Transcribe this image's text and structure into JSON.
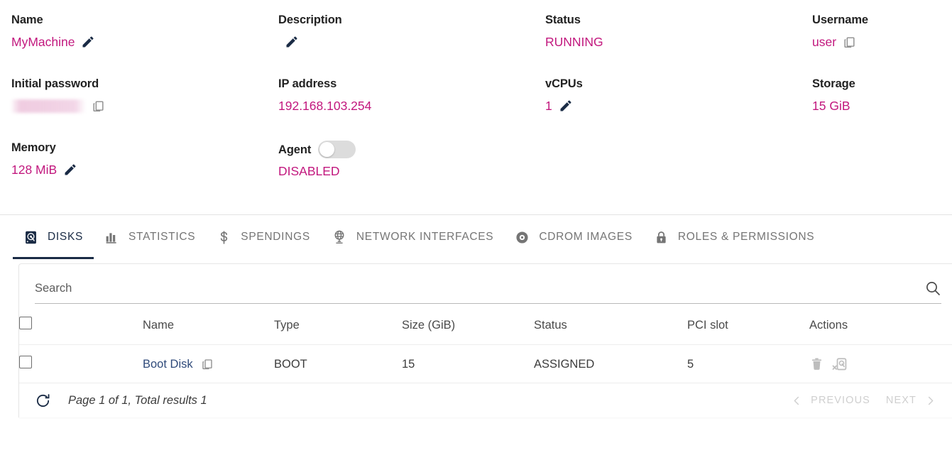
{
  "accent_color": "#c2187e",
  "navy_color": "#1a2b45",
  "link_color": "#2f4a7a",
  "summary": {
    "fields": [
      {
        "label": "Name",
        "value": "MyMachine",
        "icon": "pencil-icon"
      },
      {
        "label": "Description",
        "value": "",
        "icon": "pencil-icon"
      },
      {
        "label": "Status",
        "value": "RUNNING",
        "icon": ""
      },
      {
        "label": "Username",
        "value": "user",
        "icon": "copy-icon"
      },
      {
        "label": "Initial password",
        "value": "",
        "icon": "copy-icon"
      },
      {
        "label": "IP address",
        "value": "192.168.103.254",
        "icon": ""
      },
      {
        "label": "vCPUs",
        "value": "1",
        "icon": "pencil-icon"
      },
      {
        "label": "Storage",
        "value": "15 GiB",
        "icon": ""
      },
      {
        "label": "Memory",
        "value": "128 MiB",
        "icon": "pencil-icon"
      },
      {
        "label": "Agent",
        "value": "DISABLED",
        "icon": "toggle-switch",
        "toggle_state": "off"
      }
    ]
  },
  "tabs": [
    {
      "label": "DISKS",
      "icon": "harddisk-icon",
      "active": true
    },
    {
      "label": "STATISTICS",
      "icon": "barchart-icon",
      "active": false
    },
    {
      "label": "SPENDINGS",
      "icon": "dollar-icon",
      "active": false
    },
    {
      "label": "NETWORK INTERFACES",
      "icon": "globe-icon",
      "active": false
    },
    {
      "label": "CDROM IMAGES",
      "icon": "disc-icon",
      "active": false
    },
    {
      "label": "ROLES & PERMISSIONS",
      "icon": "lock-icon",
      "active": false
    }
  ],
  "search": {
    "placeholder": "Search",
    "value": "",
    "icon": "search-icon"
  },
  "table": {
    "columns": [
      "",
      "Name",
      "Type",
      "Size (GiB)",
      "Status",
      "PCI slot",
      "Actions"
    ],
    "rows": [
      {
        "name": "Boot Disk",
        "type": "BOOT",
        "size": "15",
        "status": "ASSIGNED",
        "pci_slot": "5",
        "actions": [
          "delete-icon",
          "detach-disk-icon"
        ]
      }
    ]
  },
  "footer": {
    "refresh_icon": "refresh-icon",
    "page_info": "Page 1 of 1, Total results 1",
    "previous_label": "PREVIOUS",
    "next_label": "NEXT"
  }
}
